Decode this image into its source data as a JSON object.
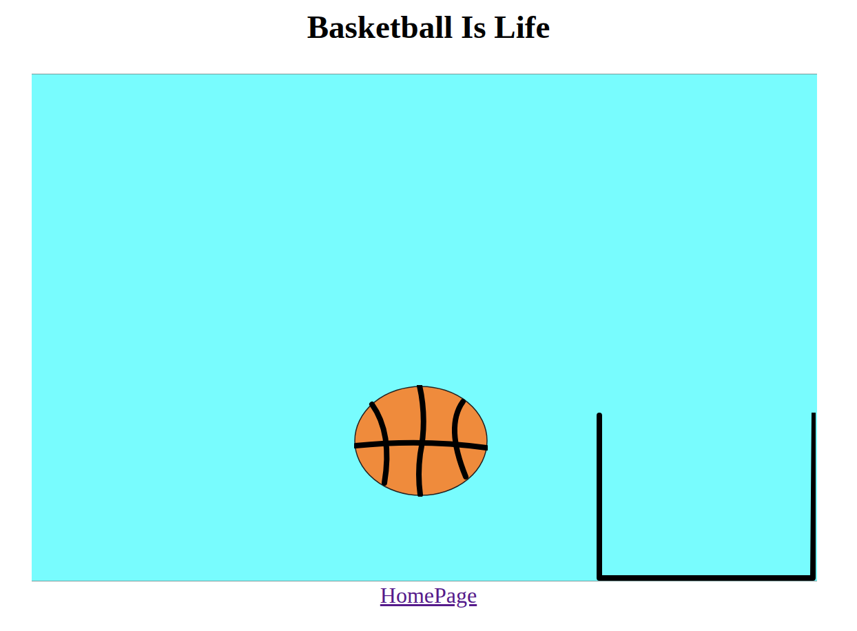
{
  "title": "Basketball Is Life",
  "link": {
    "label": "HomePage"
  }
}
